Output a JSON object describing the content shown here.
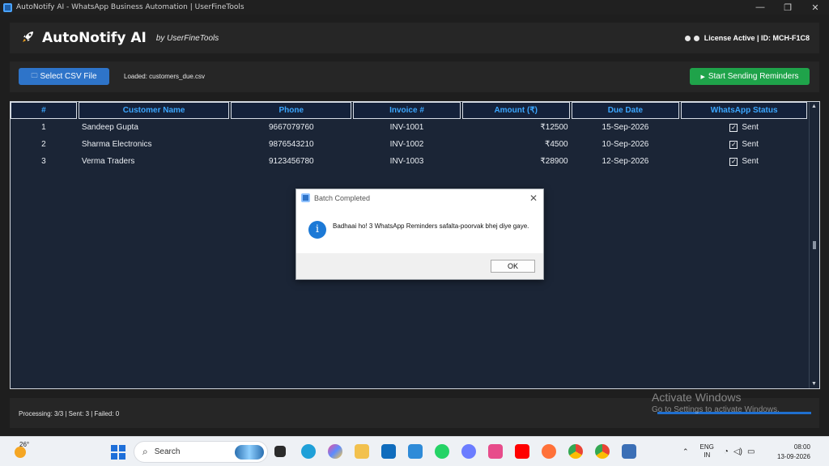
{
  "window": {
    "title": "AutoNotify AI - WhatsApp Business Automation | UserFineTools",
    "minimize": "—",
    "maximize": "❐",
    "close": "✕"
  },
  "header": {
    "brand": "AutoNotify AI",
    "by": "by UserFineTools",
    "license": "License Active | ID: MCH-F1C8",
    "icon": "rocket-icon"
  },
  "toolbar": {
    "select_csv": "Select CSV File",
    "loaded": "Loaded: customers_due.csv",
    "start": "Start Sending Reminders",
    "start_color": "#1fa34a",
    "csv_color": "#2e74c9"
  },
  "table": {
    "columns": [
      "#",
      "Customer Name",
      "Phone",
      "Invoice #",
      "Amount (₹)",
      "Due Date",
      "WhatsApp Status"
    ],
    "rows": [
      {
        "num": "1",
        "name": "Sandeep Gupta",
        "phone": "9667079760",
        "invoice": "INV-1001",
        "amount": "₹12500",
        "due": "15-Sep-2026",
        "status": "Sent"
      },
      {
        "num": "2",
        "name": "Sharma Electronics",
        "phone": "9876543210",
        "invoice": "INV-1002",
        "amount": "₹4500",
        "due": "10-Sep-2026",
        "status": "Sent"
      },
      {
        "num": "3",
        "name": "Verma Traders",
        "phone": "9123456780",
        "invoice": "INV-1003",
        "amount": "₹28900",
        "due": "12-Sep-2026",
        "status": "Sent"
      }
    ],
    "header_color": "#3ca7ff"
  },
  "status": {
    "text": "Processing: 3/3 | Sent: 3 | Failed: 0",
    "progress": 1.0
  },
  "watermark": {
    "line1": "Activate Windows",
    "line2": "Go to Settings to activate Windows."
  },
  "dialog": {
    "title": "Batch Completed",
    "message": "Badhaai ho! 3 WhatsApp Reminders safalta-poorvak bhej diye gaye.",
    "ok": "OK",
    "icon": "info-icon"
  },
  "taskbar": {
    "temp": "26°",
    "search": "Search",
    "lang1": "ENG",
    "lang2": "IN",
    "time": "08:00",
    "date": "13-09-2026"
  }
}
